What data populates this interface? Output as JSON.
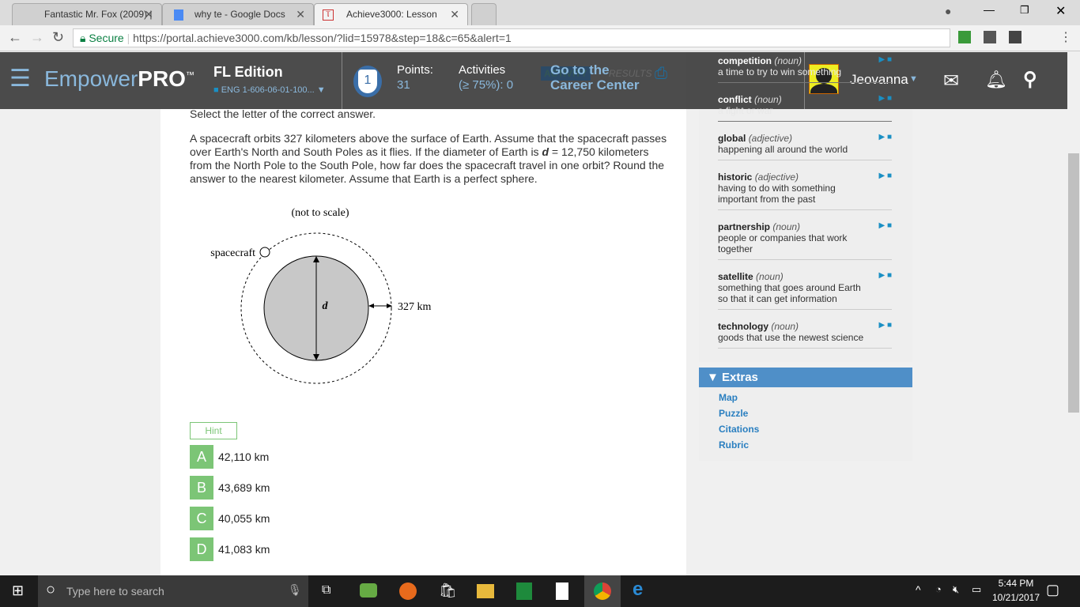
{
  "browser": {
    "tabs": [
      {
        "title": "Fantastic Mr. Fox (2009) |"
      },
      {
        "title": "why te - Google Docs"
      },
      {
        "title": "Achieve3000: Lesson"
      }
    ],
    "secure_label": "Secure",
    "url": "https://portal.achieve3000.com/kb/lesson/?lid=15978&step=18&c=65&alert=1"
  },
  "header": {
    "logo_light": "Empower",
    "logo_bold": "PRO",
    "logo_tm": "™",
    "edition": "FL Edition",
    "course": "ENG 1-606-06-01-100...",
    "level": "1",
    "points_label": "Points:",
    "points": "31",
    "activities_label": "Activities",
    "activities_sub": "(≥ 75%): 0",
    "career_line1": "Go to the",
    "career_line2": "Career Center",
    "activity_tab": "ACTIVITY",
    "results_tab": "RESULTS",
    "user": "Jeovanna"
  },
  "question": {
    "instruction": "Select the letter of the correct answer.",
    "text_pre": "A spacecraft orbits 327 kilometers above the surface of Earth. Assume that the spacecraft passes over Earth's North and South Poles as it flies. If the diameter of Earth is ",
    "var": "d",
    "text_post": " = 12,750 kilometers from the North Pole to the South Pole, how far does the spacecraft travel in one orbit? Round the answer to the nearest kilometer. Assume that Earth is a perfect sphere.",
    "diagram": {
      "note": "(not to scale)",
      "spacecraft": "spacecraft",
      "d": "d",
      "altitude": "327 km"
    },
    "hint": "Hint",
    "choices": [
      {
        "letter": "A",
        "text": "42,110 km"
      },
      {
        "letter": "B",
        "text": "43,689 km"
      },
      {
        "letter": "C",
        "text": "40,055 km"
      },
      {
        "letter": "D",
        "text": "41,083 km"
      }
    ]
  },
  "vocab": [
    {
      "word": "competition",
      "pos": "(noun)",
      "def": "a time to try to win something"
    },
    {
      "word": "conflict",
      "pos": "(noun)",
      "def": "a fight or war"
    },
    {
      "word": "global",
      "pos": "(adjective)",
      "def": "happening all around the world"
    },
    {
      "word": "historic",
      "pos": "(adjective)",
      "def": "having to do with something important from the past"
    },
    {
      "word": "partnership",
      "pos": "(noun)",
      "def": "people or companies that work together"
    },
    {
      "word": "satellite",
      "pos": "(noun)",
      "def": "something that goes around Earth so that it can get information"
    },
    {
      "word": "technology",
      "pos": "(noun)",
      "def": "goods that use the newest science"
    }
  ],
  "extras": {
    "title": "Extras",
    "links": [
      "Map",
      "Puzzle",
      "Citations",
      "Rubric"
    ]
  },
  "taskbar": {
    "search_placeholder": "Type here to search",
    "time": "5:44 PM",
    "date": "10/21/2017"
  }
}
